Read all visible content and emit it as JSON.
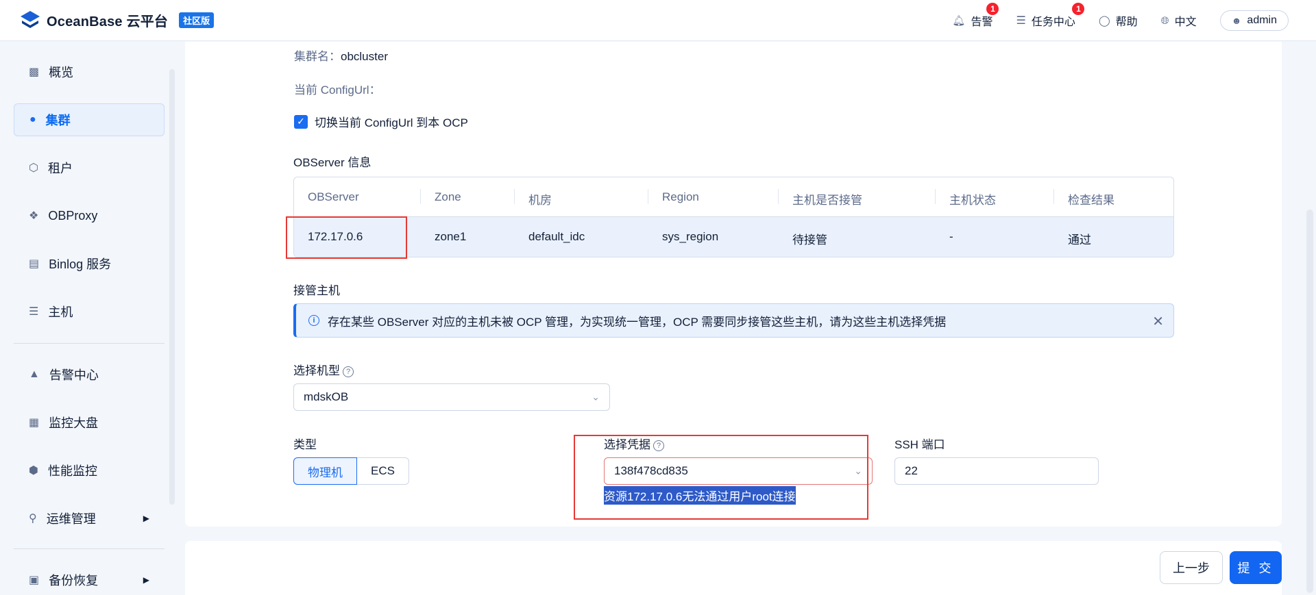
{
  "header": {
    "brand": "OceanBase 云平台",
    "edition": "社区版",
    "alerts_label": "告警",
    "alerts_badge": "1",
    "tasks_label": "任务中心",
    "tasks_badge": "1",
    "help_label": "帮助",
    "lang_label": "中文",
    "user_label": "admin"
  },
  "sidebar": {
    "items": [
      {
        "label": "概览"
      },
      {
        "label": "集群"
      },
      {
        "label": "租户"
      },
      {
        "label": "OBProxy"
      },
      {
        "label": "Binlog 服务"
      },
      {
        "label": "主机"
      },
      {
        "label": "告警中心"
      },
      {
        "label": "监控大盘"
      },
      {
        "label": "性能监控"
      },
      {
        "label": "运维管理"
      },
      {
        "label": "备份恢复"
      }
    ]
  },
  "form": {
    "cluster_name_label": "集群名：",
    "cluster_name_value": "obcluster",
    "config_url_label": "当前 ConfigUrl：",
    "switch_config_label": "切换当前 ConfigUrl 到本 OCP",
    "observer_section_title": "OBServer 信息",
    "table": {
      "headers": [
        "OBServer",
        "Zone",
        "机房",
        "Region",
        "主机是否接管",
        "主机状态",
        "检查结果"
      ],
      "rows": [
        [
          "172.17.0.6",
          "zone1",
          "default_idc",
          "sys_region",
          "待接管",
          "-",
          "通过"
        ]
      ]
    },
    "takeover_section_title": "接管主机",
    "alert_text": "存在某些 OBServer 对应的主机未被 OCP 管理，为实现统一管理，OCP 需要同步接管这些主机，请为这些主机选择凭据",
    "machine_type_label": "选择机型",
    "machine_type_value": "mdskOB",
    "type_label": "类型",
    "type_options": [
      "物理机",
      "ECS"
    ],
    "credential_label": "选择凭据",
    "credential_value": "138f478cd835",
    "credential_error": "资源172.17.0.6无法通过用户root连接",
    "ssh_port_label": "SSH 端口",
    "ssh_port_value": "22"
  },
  "footer": {
    "prev_label": "上一步",
    "submit_label": "提 交"
  },
  "colors": {
    "accent": "#1a6cf0",
    "annotation_red": "#e53935"
  }
}
